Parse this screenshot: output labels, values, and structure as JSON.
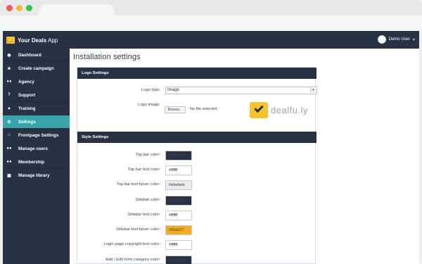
{
  "app": {
    "brand_name": "Your Deals",
    "brand_suffix": " App",
    "user_name": "Demo User"
  },
  "sidebar": {
    "items": [
      {
        "label": "Dashboard",
        "icon": "dashboard-icon"
      },
      {
        "label": "Create campaign",
        "icon": "star-icon"
      },
      {
        "label": "Agency",
        "icon": "users-icon"
      },
      {
        "label": "Support",
        "icon": "question-circle-icon"
      },
      {
        "label": "Training",
        "icon": "graduation-cap-icon"
      },
      {
        "label": "Settings",
        "icon": "gears-icon"
      },
      {
        "label": "Frontpage Settings",
        "icon": "home-icon"
      },
      {
        "label": "Manage users",
        "icon": "users-icon"
      },
      {
        "label": "Membership",
        "icon": "users-icon"
      },
      {
        "label": "Manage library",
        "icon": "image-icon"
      }
    ]
  },
  "page": {
    "title": "Installation settings"
  },
  "logo_settings": {
    "title": "Logo Settings",
    "logo_type_label": "Logo type:",
    "logo_type_value": "Image",
    "logo_image_label": "Logo image:",
    "browse_label": "Browse...",
    "file_status": "No file selected.",
    "preview_text": "dealfu.ly"
  },
  "style_settings": {
    "title": "Style Settings",
    "fields": [
      {
        "label": "Top bar color:",
        "value": "#283244"
      },
      {
        "label": "Top bar text color:",
        "value": "#ffffff"
      },
      {
        "label": "Top bar text hover color:",
        "value": "#ebebeb"
      },
      {
        "label": "Sidebar color:",
        "value": "#283244"
      },
      {
        "label": "Sidebar text color:",
        "value": "#ffffff"
      },
      {
        "label": "Sidebar text hover color:",
        "value": "#f2ab27"
      },
      {
        "label": "Login page copyright text color:",
        "value": "#ffffff"
      },
      {
        "label": "Add / Edit form category color:",
        "value": "#283244"
      }
    ]
  },
  "colors": {
    "sidebar": "#283244",
    "active": "#37a5a9",
    "accent": "#f2ab27",
    "logo_yellow": "#f4c52d"
  }
}
